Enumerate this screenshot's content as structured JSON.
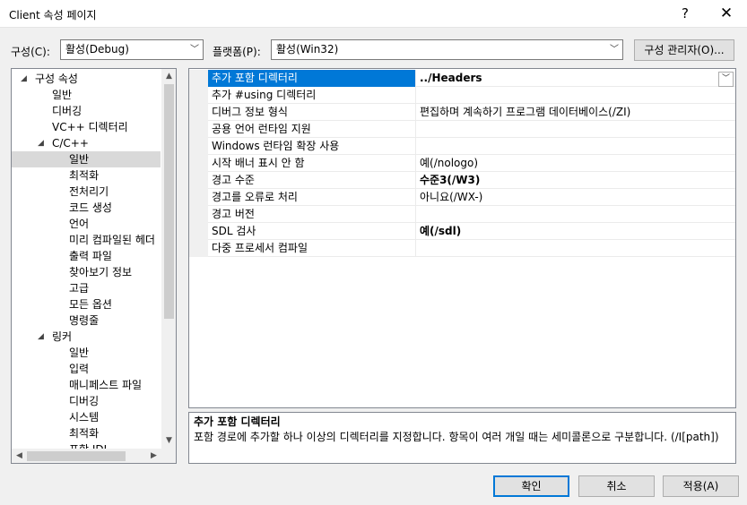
{
  "window": {
    "title": "Client 속성 페이지",
    "help": "?",
    "close": "✕"
  },
  "toolbar": {
    "config_label": "구성(C):",
    "config_value": "활성(Debug)",
    "platform_label": "플랫폼(P):",
    "platform_value": "활성(Win32)",
    "config_manager": "구성 관리자(O)...",
    "dropdown_arrow": "﹀"
  },
  "tree": {
    "items": [
      {
        "label": "구성 속성",
        "level": 0,
        "expanded": true
      },
      {
        "label": "일반",
        "level": 1
      },
      {
        "label": "디버깅",
        "level": 1
      },
      {
        "label": "VC++ 디렉터리",
        "level": 1
      },
      {
        "label": "C/C++",
        "level": 1,
        "expanded": true
      },
      {
        "label": "일반",
        "level": 2,
        "selected": true
      },
      {
        "label": "최적화",
        "level": 2
      },
      {
        "label": "전처리기",
        "level": 2
      },
      {
        "label": "코드 생성",
        "level": 2
      },
      {
        "label": "언어",
        "level": 2
      },
      {
        "label": "미리 컴파일된 헤더",
        "level": 2
      },
      {
        "label": "출력 파일",
        "level": 2
      },
      {
        "label": "찾아보기 정보",
        "level": 2
      },
      {
        "label": "고급",
        "level": 2
      },
      {
        "label": "모든 옵션",
        "level": 2
      },
      {
        "label": "명령줄",
        "level": 2
      },
      {
        "label": "링커",
        "level": 1,
        "expanded": true
      },
      {
        "label": "일반",
        "level": 2
      },
      {
        "label": "입력",
        "level": 2
      },
      {
        "label": "매니페스트 파일",
        "level": 2
      },
      {
        "label": "디버깅",
        "level": 2
      },
      {
        "label": "시스템",
        "level": 2
      },
      {
        "label": "최적화",
        "level": 2
      },
      {
        "label": "포함 IDL",
        "level": 2
      }
    ]
  },
  "grid": {
    "rows": [
      {
        "name": "추가 포함 디렉터리",
        "value": "../Headers",
        "bold": true,
        "selected": true
      },
      {
        "name": "추가 #using 디렉터리",
        "value": ""
      },
      {
        "name": "디버그 정보 형식",
        "value": "편집하며 계속하기 프로그램 데이터베이스(/ZI)"
      },
      {
        "name": "공용 언어 런타임 지원",
        "value": ""
      },
      {
        "name": "Windows 런타임 확장 사용",
        "value": ""
      },
      {
        "name": "시작 배너 표시 안 함",
        "value": "예(/nologo)"
      },
      {
        "name": "경고 수준",
        "value": "수준3(/W3)",
        "bold": true
      },
      {
        "name": "경고를 오류로 처리",
        "value": "아니요(/WX-)"
      },
      {
        "name": "경고 버전",
        "value": ""
      },
      {
        "name": "SDL 검사",
        "value": "예(/sdl)",
        "bold": true
      },
      {
        "name": "다중 프로세서 컴파일",
        "value": ""
      }
    ]
  },
  "description": {
    "title": "추가 포함 디렉터리",
    "text": "포함 경로에 추가할 하나 이상의 디렉터리를 지정합니다. 항목이 여러 개일 때는 세미콜론으로 구분합니다. (/I[path])"
  },
  "buttons": {
    "ok": "확인",
    "cancel": "취소",
    "apply": "적용(A)"
  },
  "colors": {
    "selection": "#0078d7",
    "tree_selection": "#d9d9d9"
  }
}
